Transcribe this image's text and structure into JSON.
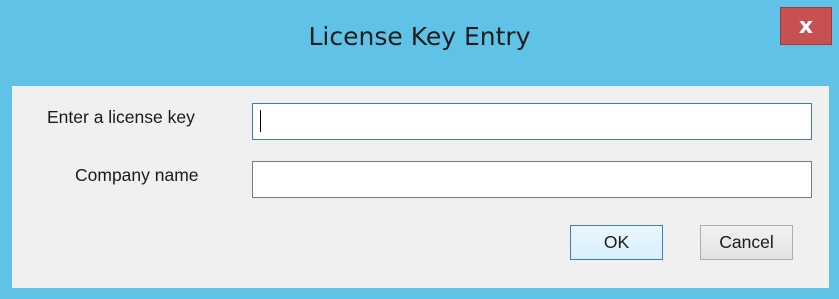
{
  "window": {
    "title": "License Key Entry",
    "close_glyph": "x",
    "frame_color": "#60c2e6",
    "close_color": "#c75050"
  },
  "form": {
    "license_key_label": "Enter a license key",
    "license_key_value": "",
    "company_label": "Company name",
    "company_value": ""
  },
  "buttons": {
    "ok_label": "OK",
    "cancel_label": "Cancel"
  }
}
